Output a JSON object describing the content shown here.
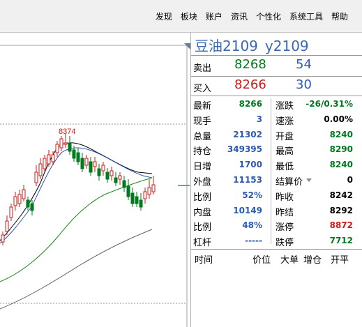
{
  "menu": [
    "发现",
    "板块",
    "账户",
    "资讯",
    "个性化",
    "系统工具",
    "帮助"
  ],
  "quote": {
    "name": "豆油2109",
    "code": "y2109",
    "sell_label": "卖出",
    "sell_price": "8268",
    "sell_volume": "54",
    "buy_label": "买入",
    "buy_price": "8266",
    "buy_volume": "30",
    "rows": [
      {
        "l1": "最新",
        "v1": "8266",
        "c1": "green",
        "l2": "涨跌",
        "v2": "-26/0.31%",
        "c2": "green"
      },
      {
        "l1": "现手",
        "v1": "3",
        "c1": "blue",
        "l2": "速涨",
        "v2": "0.00%",
        "c2": "black"
      },
      {
        "l1": "总量",
        "v1": "21302",
        "c1": "blue",
        "l2": "开盘",
        "v2": "8240",
        "c2": "green"
      },
      {
        "l1": "持仓",
        "v1": "349395",
        "c1": "blue",
        "l2": "最高",
        "v2": "8290",
        "c2": "green"
      },
      {
        "l1": "日增",
        "v1": "1700",
        "c1": "blue",
        "l2": "最低",
        "v2": "8240",
        "c2": "green"
      },
      {
        "l1": "外盘",
        "v1": "11153",
        "c1": "blue",
        "l2": "结算价",
        "v2": "0",
        "c2": "black"
      },
      {
        "l1": "比例",
        "v1": "52%",
        "c1": "blue",
        "l2": "昨收",
        "v2": "8242",
        "c2": "black"
      },
      {
        "l1": "内盘",
        "v1": "10149",
        "c1": "blue",
        "l2": "昨结",
        "v2": "8292",
        "c2": "black"
      },
      {
        "l1": "比例",
        "v1": "48%",
        "c1": "blue",
        "l2": "涨停",
        "v2": "8872",
        "c2": "red"
      },
      {
        "l1": "杠杆",
        "v1": "-----",
        "c1": "blue",
        "l2": "跌停",
        "v2": "7712",
        "c2": "green"
      }
    ],
    "tick_headers": [
      "时间",
      "价位",
      "大单",
      "增仓",
      "开平"
    ]
  },
  "chart": {
    "high_label": "8374",
    "colors": {
      "up": "#d01818",
      "down": "#007a1e",
      "ma_short": "#000000",
      "ma_mid": "#2b58b0",
      "ma_long": "#1a8a1a",
      "ma_xlong": "#606070"
    }
  }
}
